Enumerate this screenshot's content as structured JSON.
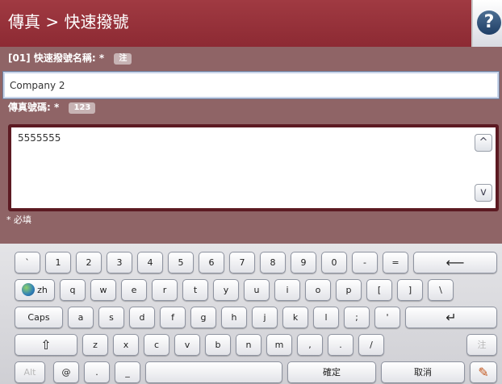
{
  "header": {
    "title": "傳真 > 快速撥號",
    "help_glyph": "?"
  },
  "name_field": {
    "label": "[01] 快速撥號名稱:",
    "required_mark": "*",
    "hint": "注",
    "value": "Company 2"
  },
  "fax_field": {
    "label": "傳真號碼:",
    "required_mark": "*",
    "hint": "123",
    "value": "5555555",
    "scroll_up": "^",
    "scroll_down": "v"
  },
  "required_note": "* 必填",
  "keyboard": {
    "row1": [
      "`",
      "1",
      "2",
      "3",
      "4",
      "5",
      "6",
      "7",
      "8",
      "9",
      "0",
      "-",
      "=",
      "⟵"
    ],
    "row2": [
      "zh",
      "q",
      "w",
      "e",
      "r",
      "t",
      "y",
      "u",
      "i",
      "o",
      "p",
      "[",
      "]",
      "\\"
    ],
    "row3": [
      "Caps",
      "a",
      "s",
      "d",
      "f",
      "g",
      "h",
      "j",
      "k",
      "l",
      ";",
      "'",
      "↵"
    ],
    "row4": [
      "⇧",
      "z",
      "x",
      "c",
      "v",
      "b",
      "n",
      "m",
      ",",
      ".",
      "/",
      "注"
    ],
    "row5": [
      "Alt",
      "@",
      ".",
      "_",
      "",
      "確定",
      "取消",
      "✎"
    ]
  },
  "colors": {
    "titlebar": "#96323b",
    "panel": "#8f6466",
    "field_border": "#5c1a22"
  }
}
